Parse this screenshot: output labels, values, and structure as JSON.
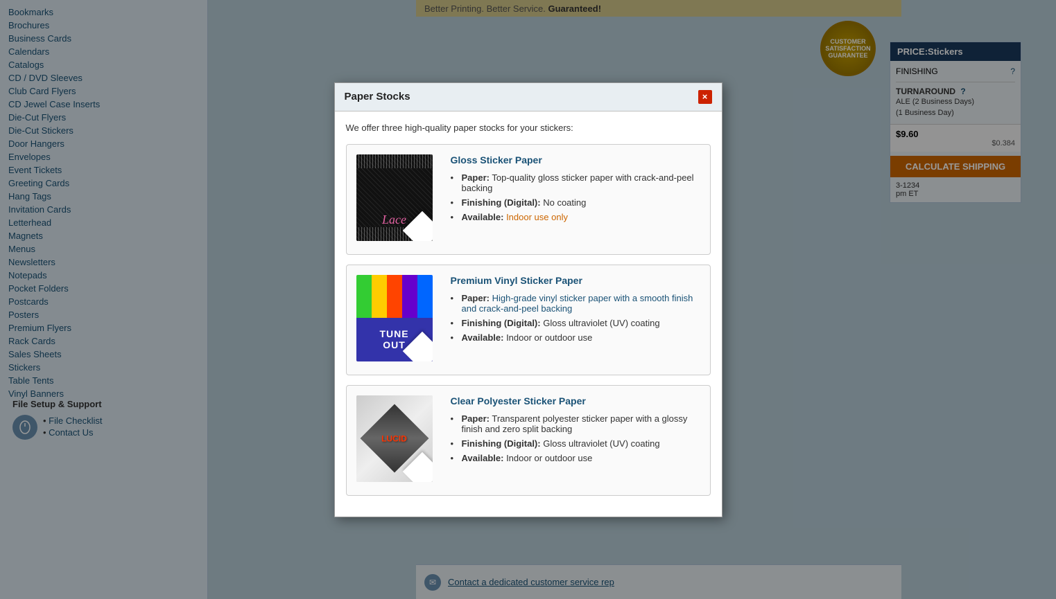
{
  "page": {
    "title": "Paper Stocks",
    "background_color": "#7a9ab5"
  },
  "top_banner": {
    "text_normal": "Better Printing. Better Service.",
    "text_bold": "Guaranteed!"
  },
  "sidebar": {
    "nav_items": [
      {
        "label": "Bookmarks",
        "href": "#"
      },
      {
        "label": "Brochures",
        "href": "#"
      },
      {
        "label": "Business Cards",
        "href": "#"
      },
      {
        "label": "Calendars",
        "href": "#"
      },
      {
        "label": "Catalogs",
        "href": "#"
      },
      {
        "label": "CD / DVD Sleeves",
        "href": "#"
      },
      {
        "label": "Club Card Flyers",
        "href": "#"
      },
      {
        "label": "CD Jewel Case Inserts",
        "href": "#"
      },
      {
        "label": "Die-Cut Flyers",
        "href": "#"
      },
      {
        "label": "Die-Cut Stickers",
        "href": "#"
      },
      {
        "label": "Door Hangers",
        "href": "#"
      },
      {
        "label": "Envelopes",
        "href": "#"
      },
      {
        "label": "Event Tickets",
        "href": "#"
      },
      {
        "label": "Greeting Cards",
        "href": "#"
      },
      {
        "label": "Hang Tags",
        "href": "#"
      },
      {
        "label": "Invitation Cards",
        "href": "#"
      },
      {
        "label": "Letterhead",
        "href": "#"
      },
      {
        "label": "Magnets",
        "href": "#"
      },
      {
        "label": "Menus",
        "href": "#"
      },
      {
        "label": "Newsletters",
        "href": "#"
      },
      {
        "label": "Notepads",
        "href": "#"
      },
      {
        "label": "Pocket Folders",
        "href": "#"
      },
      {
        "label": "Postcards",
        "href": "#"
      },
      {
        "label": "Posters",
        "href": "#"
      },
      {
        "label": "Premium Flyers",
        "href": "#"
      },
      {
        "label": "Rack Cards",
        "href": "#"
      },
      {
        "label": "Sales Sheets",
        "href": "#"
      },
      {
        "label": "Stickers",
        "href": "#"
      },
      {
        "label": "Table Tents",
        "href": "#"
      },
      {
        "label": "Vinyl Banners",
        "href": "#"
      }
    ],
    "file_setup": {
      "heading": "File Setup & Support",
      "links": [
        {
          "label": "File Checklist",
          "href": "#"
        },
        {
          "label": "Contact Us",
          "href": "#"
        }
      ]
    }
  },
  "price_panel": {
    "header": "PRICE:Stickers",
    "finishing_label": "FINISHING",
    "turnaround_label": "TURNAROUND",
    "standard_label": "ALE (2 Business Days)",
    "rush_label": "(1 Business Day)",
    "total_price": "$9.60",
    "per_piece": "$0.384",
    "calc_button": "CALCULATE SHIPPING",
    "service_number": "3-1234",
    "service_hours": "pm ET"
  },
  "satisfaction_badge": {
    "line1": "CUSTOMER",
    "line2": "SATISFACTION",
    "line3": "GUARANTEE"
  },
  "modal": {
    "title": "Paper Stocks",
    "intro": "We offer three high-quality paper stocks for your stickers:",
    "close_label": "×",
    "stocks": [
      {
        "id": "gloss",
        "name": "Gloss Sticker Paper",
        "paper_label": "Paper:",
        "paper_value": "Top-quality gloss sticker paper with crack-and-peel backing",
        "finishing_label": "Finishing (Digital):",
        "finishing_value": "No coating",
        "available_label": "Available:",
        "available_value": "Indoor use only",
        "available_color": "orange",
        "image_alt": "Gloss sticker sample - Lace design"
      },
      {
        "id": "vinyl",
        "name": "Premium Vinyl Sticker Paper",
        "paper_label": "Paper:",
        "paper_value": "High-grade vinyl sticker paper with a smooth finish and crack-and-peel backing",
        "finishing_label": "Finishing (Digital):",
        "finishing_value": "Gloss ultraviolet (UV) coating",
        "available_label": "Available:",
        "available_value": "Indoor or outdoor use",
        "available_color": "blue",
        "image_alt": "Vinyl sticker sample - Tune Out design"
      },
      {
        "id": "clear",
        "name": "Clear Polyester Sticker Paper",
        "paper_label": "Paper:",
        "paper_value": "Transparent polyester sticker paper with a glossy finish and zero split backing",
        "finishing_label": "Finishing (Digital):",
        "finishing_value": "Gloss ultraviolet (UV) coating",
        "available_label": "Available:",
        "available_value": "Indoor or outdoor use",
        "available_color": "blue",
        "image_alt": "Clear sticker sample - Lucid design"
      }
    ]
  },
  "bottom_contact": {
    "text": "Contact a dedicated customer service rep",
    "href": "#"
  }
}
